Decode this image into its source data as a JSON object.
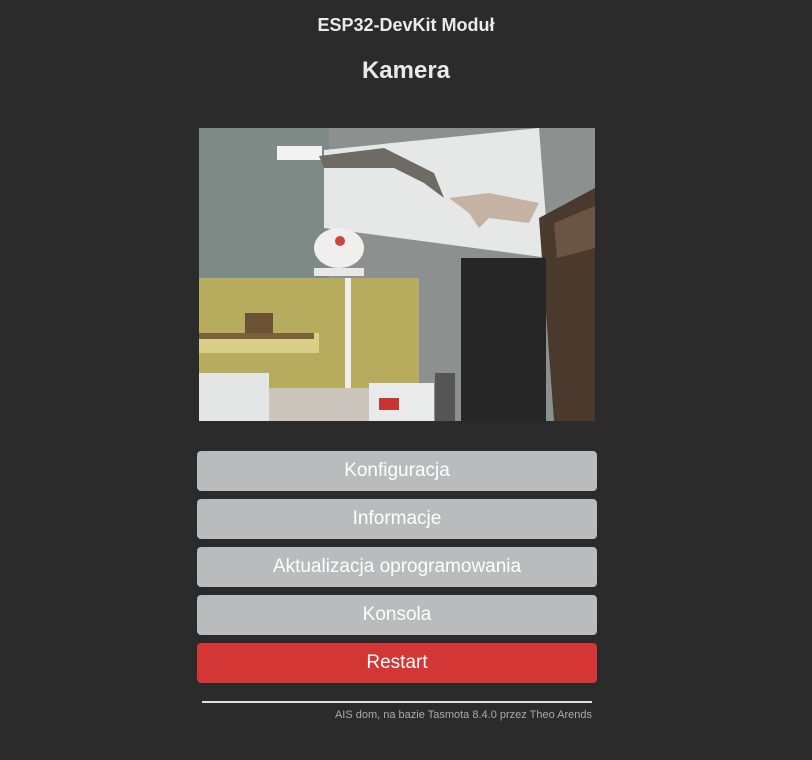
{
  "header": {
    "module_name": "ESP32-DevKit Moduł",
    "page_title": "Kamera"
  },
  "camera": {
    "image_label": "camera-stream"
  },
  "menu": {
    "configuration": "Konfiguracja",
    "information": "Informacje",
    "firmware_update": "Aktualizacja oprogramowania",
    "console": "Konsola",
    "restart": "Restart"
  },
  "footer": {
    "text": "AIS dom, na bazie Tasmota 8.4.0 przez Theo Arends"
  },
  "colors": {
    "background": "#2b2b2b",
    "button": "#b9bbbd",
    "restart_button": "#d43535"
  }
}
